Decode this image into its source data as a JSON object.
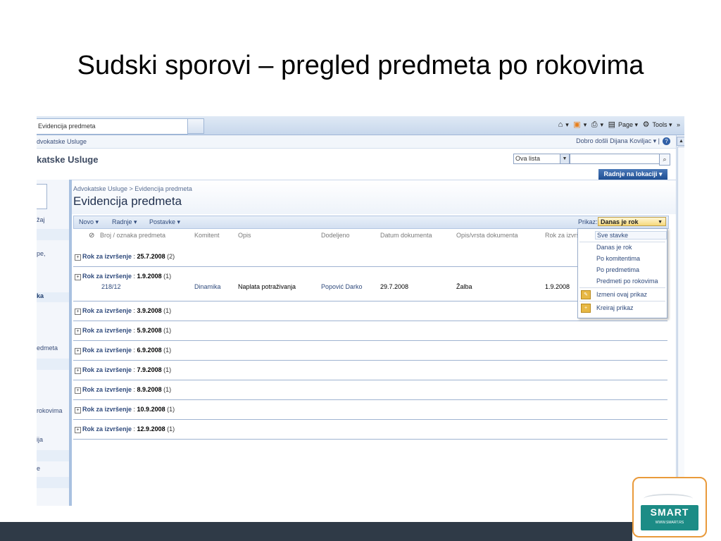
{
  "slide": {
    "title": "Sudski sporovi – pregled predmeta po rokovima"
  },
  "browser": {
    "tab_title": "Evidencija predmeta",
    "tools": {
      "page": "Page ▾",
      "tools": "Tools ▾",
      "more": "»"
    }
  },
  "sharepoint": {
    "site_link": "dvokatske Usluge",
    "welcome": "Dobro došli Dijana Koviljac ▾ |",
    "site_title": "katske Usluge",
    "search_scope": "Ova lista",
    "site_actions": "Radnje na lokaciji ▾",
    "breadcrumb": "Advokatske Usluge > Evidencija predmeta",
    "page_title": "Evidencija predmeta",
    "left_nav": [
      "žaj",
      "pe,",
      "ka",
      "edmeta",
      "rokovima",
      "ija",
      "e"
    ],
    "toolbar": {
      "new": "Novo ▾",
      "actions": "Radnje ▾",
      "settings": "Postavke ▾"
    },
    "view_label": "Prikaz:",
    "view_selected": "Danas je rok",
    "view_menu": [
      "Sve stavke",
      "Danas je rok",
      "Po komitentima",
      "Po predmetima",
      "Predmeti po rokovima",
      "Izmeni ovaj prikaz",
      "Kreiraj prikaz"
    ],
    "columns": [
      "Broj / oznaka predmeta",
      "Komitent",
      "Opis",
      "Dodeljeno",
      "Datum dokumenta",
      "Opis/vrsta dokumenta",
      "Rok za izvrše"
    ],
    "group_label": "Rok za izvršenje",
    "groups": [
      {
        "value": "25.7.2008",
        "count": "(2)"
      },
      {
        "value": "1.9.2008",
        "count": "(1)"
      },
      {
        "value": "3.9.2008",
        "count": "(1)"
      },
      {
        "value": "5.9.2008",
        "count": "(1)"
      },
      {
        "value": "6.9.2008",
        "count": "(1)"
      },
      {
        "value": "7.9.2008",
        "count": "(1)"
      },
      {
        "value": "8.9.2008",
        "count": "(1)"
      },
      {
        "value": "10.9.2008",
        "count": "(1)"
      },
      {
        "value": "12.9.2008",
        "count": "(1)"
      }
    ],
    "row": {
      "number": "218/12",
      "client": "Dinamika",
      "description": "Naplata potraživanja",
      "assigned": "Popović Darko",
      "doc_date": "29.7.2008",
      "doc_type": "Žalba",
      "deadline": "1.9.2008"
    }
  },
  "logo": {
    "text": "SMART",
    "url": "WWW.SMART.RS"
  }
}
